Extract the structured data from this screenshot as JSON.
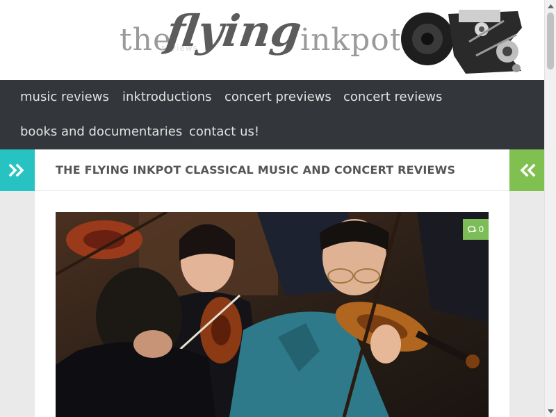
{
  "header": {
    "logo_the": "the",
    "logo_flying": "flying",
    "logo_inkpot": "inkpot",
    "logo_sub": "reviews"
  },
  "nav": {
    "items": [
      {
        "label": "music reviews"
      },
      {
        "label": "inktroductions"
      },
      {
        "label": "concert previews"
      },
      {
        "label": "concert reviews"
      },
      {
        "label": "books and documentaries"
      },
      {
        "label": "contact us!"
      }
    ]
  },
  "page": {
    "title": "THE FLYING INKPOT CLASSICAL MUSIC AND CONCERT REVIEWS"
  },
  "featured": {
    "comment_count": "0"
  },
  "icons": {
    "sidebar_left": "double-chevron-right-icon",
    "sidebar_right": "double-chevron-left-icon",
    "comments": "comments-icon"
  },
  "colors": {
    "nav_bg": "#33363b",
    "accent_teal": "#27c3c3",
    "accent_green": "#80c050"
  }
}
